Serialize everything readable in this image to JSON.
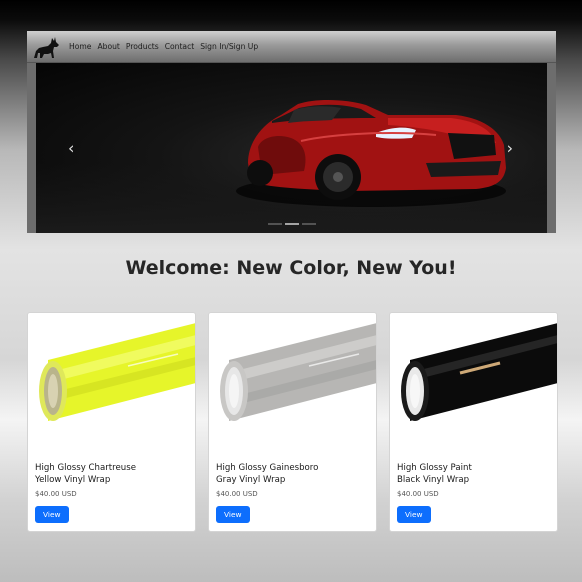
{
  "nav": {
    "logo": "wolf-logo",
    "links": [
      "Home",
      "About",
      "Products",
      "Contact",
      "Sign In/Sign Up"
    ]
  },
  "carousel": {
    "prev_icon": "chevron-left-icon",
    "next_icon": "chevron-right-icon",
    "slide": "red-car"
  },
  "headline": "Welcome: New Color, New You!",
  "products": [
    {
      "title_line1": "High Glossy Chartreuse",
      "title_line2": "Yellow Vinyl Wrap",
      "price": "$40.00 USD",
      "button": "View",
      "color": "#e6f52a"
    },
    {
      "title_line1": "High Glossy Gainesboro",
      "title_line2": "Gray Vinyl Wrap",
      "price": "$40.00 USD",
      "button": "View",
      "color": "#bdbdbd"
    },
    {
      "title_line1": "High Glossy Paint",
      "title_line2": "Black Vinyl Wrap",
      "price": "$40.00 USD",
      "button": "View",
      "color": "#0b0b0b"
    }
  ],
  "colors": {
    "accent": "#0d6efd"
  }
}
